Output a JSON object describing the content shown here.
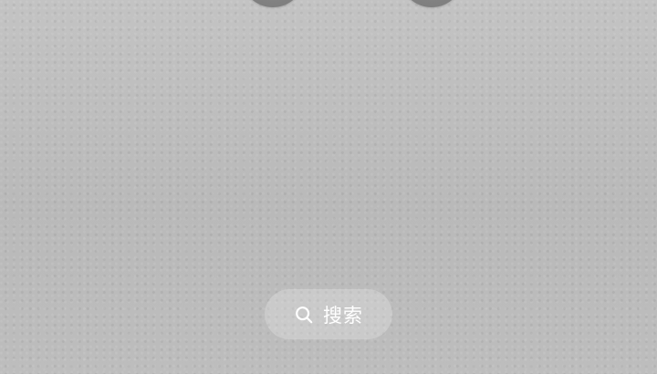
{
  "wallpaper": {
    "color": "#bcbcbc"
  },
  "top_icons": [
    {
      "name": "app-icon-left"
    },
    {
      "name": "app-icon-right"
    }
  ],
  "search": {
    "icon": "search-icon",
    "label": "搜索",
    "text_color": "#ffffff"
  }
}
